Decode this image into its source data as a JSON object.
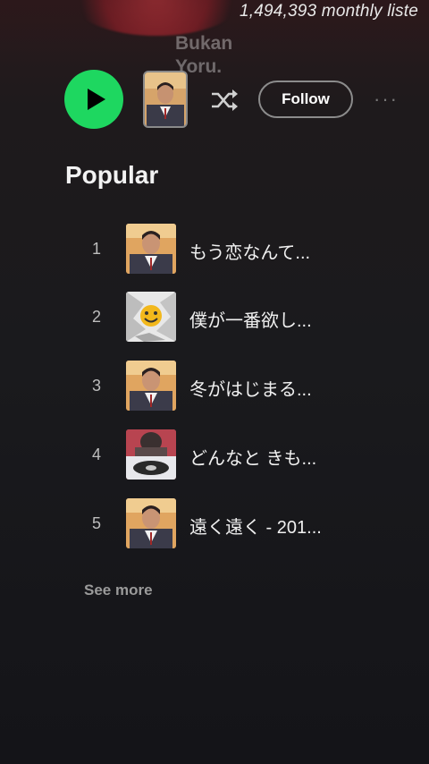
{
  "header": {
    "monthly_listeners": "1,494,393 monthly liste",
    "artist_name": "Bukan\nYoru."
  },
  "controls": {
    "play_icon": "play-icon",
    "shuffle_icon": "shuffle-icon",
    "follow_label": "Follow",
    "more_label": "···"
  },
  "popular": {
    "heading": "Popular",
    "tracks": [
      {
        "num": "1",
        "title": "もう恋なんて...",
        "art": "portrait"
      },
      {
        "num": "2",
        "title": "僕が一番欲し...",
        "art": "smiley"
      },
      {
        "num": "3",
        "title": "冬がはじまる...",
        "art": "portrait"
      },
      {
        "num": "4",
        "title": "どんなと きも...",
        "art": "records"
      },
      {
        "num": "5",
        "title": "遠く遠く - 201...",
        "art": "portrait"
      }
    ],
    "see_more": "See more"
  },
  "colors": {
    "accent_green": "#1ed760",
    "background": "#1a1a1d"
  }
}
